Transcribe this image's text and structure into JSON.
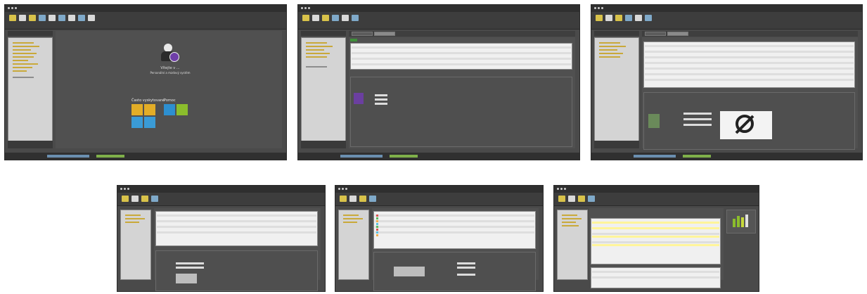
{
  "screenshots": [
    {
      "id": "s1",
      "desc": "welcome"
    },
    {
      "id": "s2",
      "desc": "list-with-details"
    },
    {
      "id": "s3",
      "desc": "list-with-photo"
    },
    {
      "id": "s4",
      "desc": "list-with-form"
    },
    {
      "id": "s5",
      "desc": "list-with-colored-icons"
    },
    {
      "id": "s6",
      "desc": "table-with-chart"
    }
  ],
  "welcome": {
    "shortcuts_title": "Často vyskytované",
    "help_title": "Pomoc",
    "app_name": "Vítejte v ...",
    "app_subtitle": "Personální a mzdový systém"
  },
  "colors": {
    "shortcut_yellow": "#e2ad27",
    "shortcut_blue": "#3a9bd6",
    "help_blue": "#2d8fd0",
    "help_green": "#8bbd2c"
  }
}
